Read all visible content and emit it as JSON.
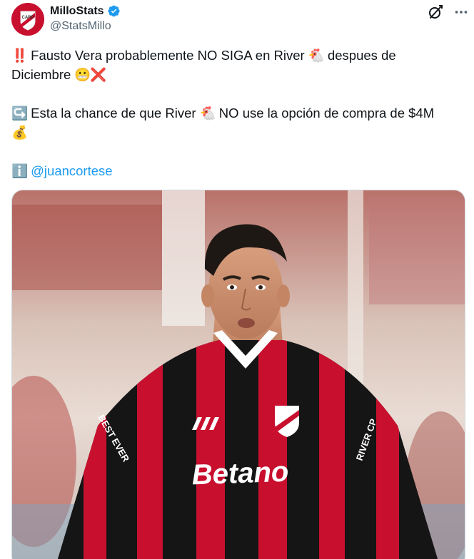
{
  "author": {
    "display_name": "MilloStats",
    "handle": "@StatsMillo",
    "verified": true,
    "avatar_icon": "river-plate-crest-icon"
  },
  "actions": {
    "grok_icon": "grok-icon",
    "more_icon": "more-horizontal-icon"
  },
  "post": {
    "line1_emoji_start": "‼️",
    "line1_text_a": " Fausto Vera probablemente NO SIGA en River ",
    "line1_emoji_mid": "🐔",
    "line1_text_b": " despues de",
    "line2_text": "Diciembre ",
    "line2_emoji_a": "😬",
    "line2_emoji_b": "❌",
    "line3_emoji_start": "↪️",
    "line3_text_a": " Esta la chance de que River ",
    "line3_emoji_mid": "🐔",
    "line3_text_b": " NO use la opción de compra de $4M",
    "line4_emoji": "💰",
    "line5_emoji": "ℹ️",
    "mention": "@juancortese"
  },
  "media": {
    "description_icon": "player-photo",
    "jersey_sponsor": "Betano",
    "jersey_text_left": "BEST EVER",
    "jersey_text_right": "RIVER CP"
  },
  "colors": {
    "accent_blue": "#1d9bf0",
    "text": "#0f1419",
    "muted": "#536471",
    "river_red": "#c8102e"
  }
}
